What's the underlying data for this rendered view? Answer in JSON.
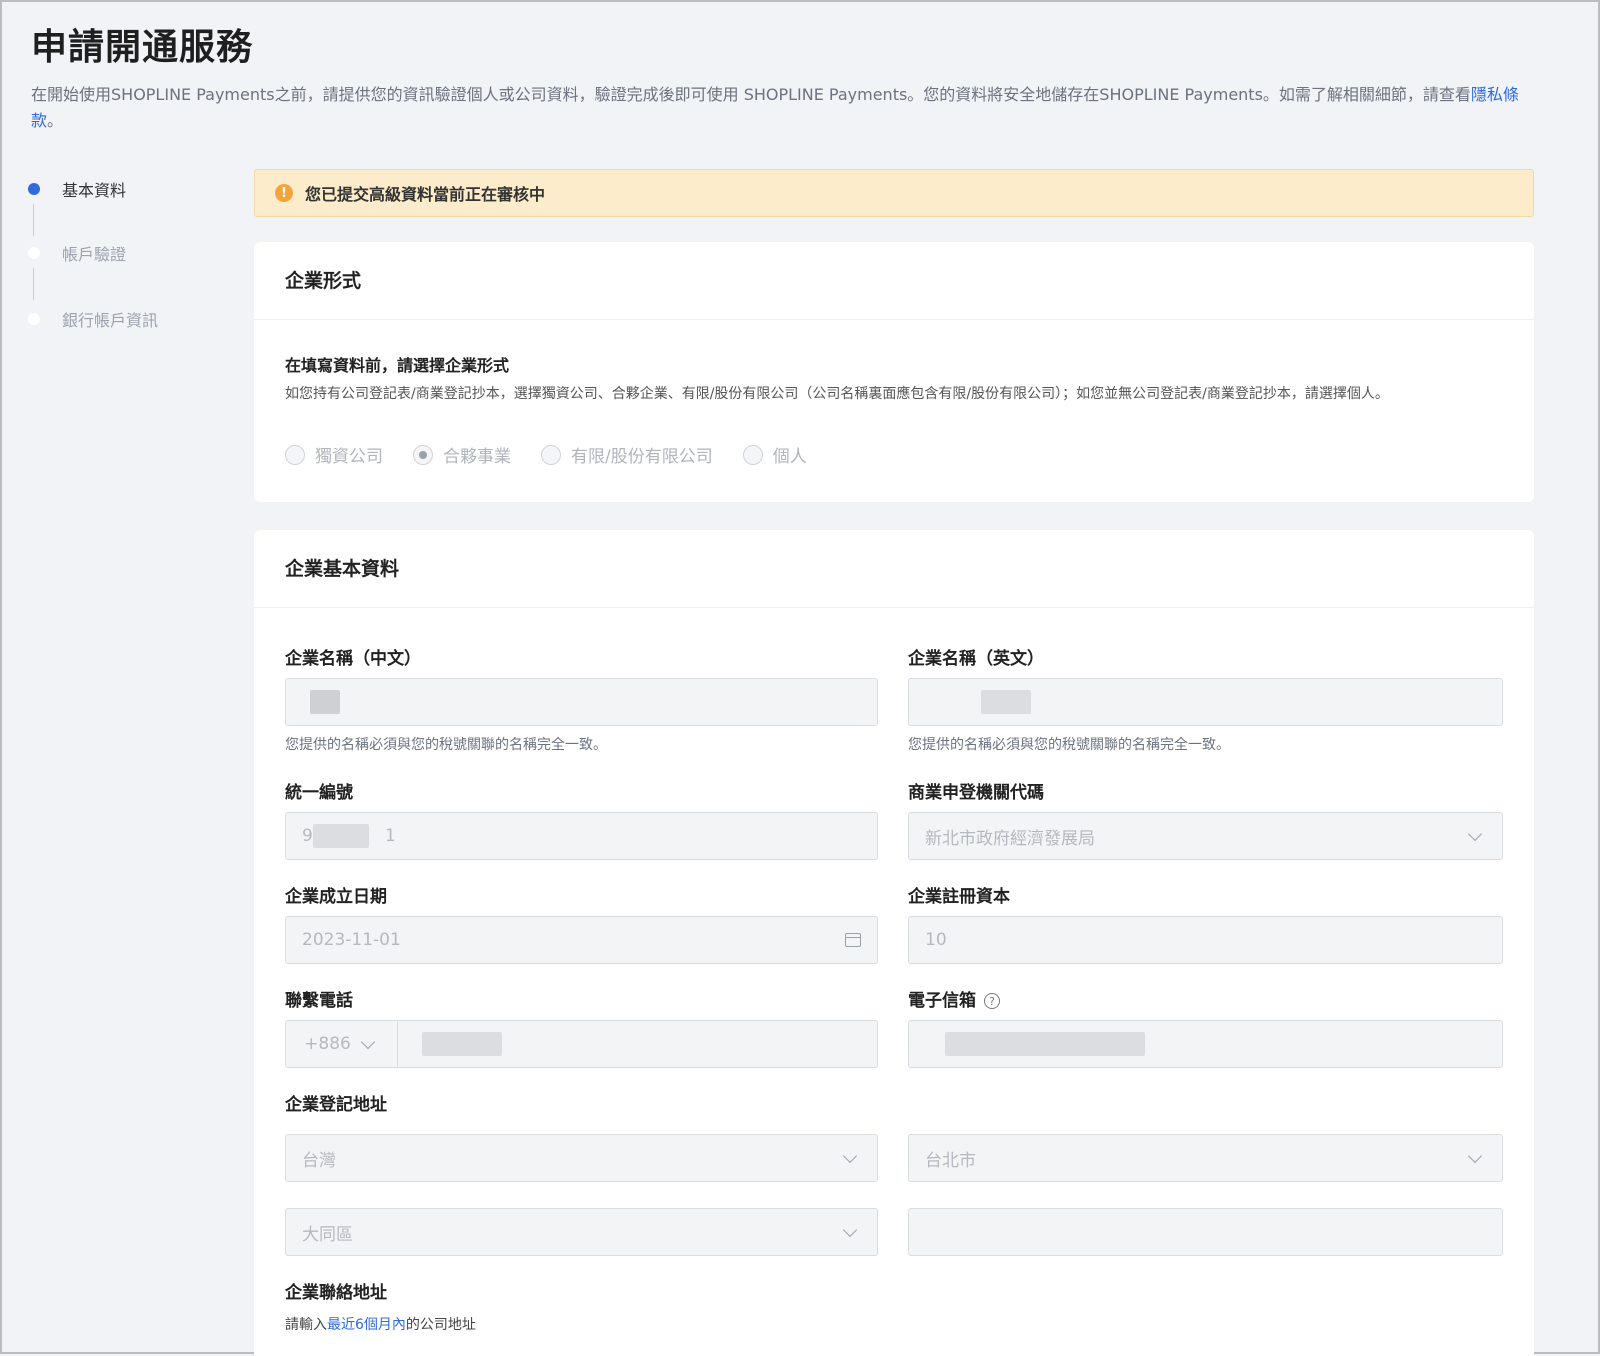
{
  "page": {
    "title": "申請開通服務",
    "description_prefix": "在開始使用SHOPLINE Payments之前，請提供您的資訊驗證個人或公司資料，驗證完成後即可使用 SHOPLINE Payments。您的資料將安全地儲存在SHOPLINE Payments。如需了解相關細節，請查看",
    "privacy_link": "隱私條款",
    "description_suffix": "。"
  },
  "steps": [
    {
      "label": "基本資料",
      "active": true
    },
    {
      "label": "帳戶驗證",
      "active": false
    },
    {
      "label": "銀行帳戶資訊",
      "active": false
    }
  ],
  "alert": {
    "icon": "warning-icon",
    "text": "您已提交高級資料當前正在審核中"
  },
  "business_type": {
    "header": "企業形式",
    "question": "在填寫資料前，請選擇企業形式",
    "help": "如您持有公司登記表/商業登記抄本，選擇獨資公司、合夥企業、有限/股份有限公司（公司名稱裏面應包含有限/股份有限公司）；如您並無公司登記表/商業登記抄本，請選擇個人。",
    "options": [
      {
        "label": "獨資公司",
        "checked": false
      },
      {
        "label": "合夥事業",
        "checked": true
      },
      {
        "label": "有限/股份有限公司",
        "checked": false
      },
      {
        "label": "個人",
        "checked": false
      }
    ]
  },
  "basic_info": {
    "header": "企業基本資料",
    "name_zh": {
      "label": "企業名稱（中文）",
      "help": "您提供的名稱必須與您的稅號關聯的名稱完全一致。"
    },
    "name_en": {
      "label": "企業名稱（英文）",
      "help": "您提供的名稱必須與您的稅號關聯的名稱完全一致。"
    },
    "tax_id": {
      "label": "統一編號",
      "prefix": "9",
      "suffix": "1"
    },
    "authority": {
      "label": "商業申登機關代碼",
      "value": "新北市政府經濟發展局"
    },
    "founded": {
      "label": "企業成立日期",
      "value": "2023-11-01"
    },
    "capital": {
      "label": "企業註冊資本",
      "value": "10"
    },
    "phone": {
      "label": "聯繫電話",
      "code": "+886"
    },
    "email": {
      "label": "電子信箱",
      "help_icon": "?"
    },
    "reg_address": {
      "label": "企業登記地址",
      "country": "台灣",
      "city": "台北市",
      "district": "大同區"
    },
    "contact_address": {
      "label": "企業聯絡地址",
      "help_prefix": "請輸入",
      "help_link": "最近6個月內",
      "help_suffix": "的公司地址"
    }
  }
}
